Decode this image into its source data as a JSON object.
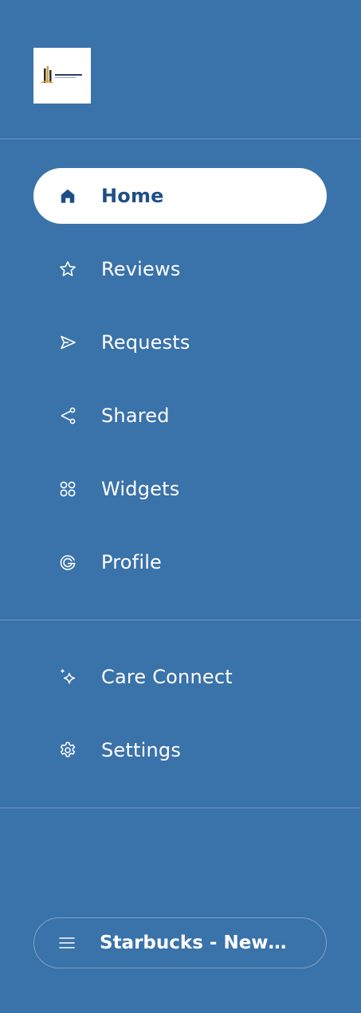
{
  "logo": {
    "alt_icon": "company-logo"
  },
  "nav": {
    "primary": [
      {
        "label": "Home",
        "icon": "home-icon",
        "active": true
      },
      {
        "label": "Reviews",
        "icon": "star-icon",
        "active": false
      },
      {
        "label": "Requests",
        "icon": "send-icon",
        "active": false
      },
      {
        "label": "Shared",
        "icon": "share-icon",
        "active": false
      },
      {
        "label": "Widgets",
        "icon": "widgets-icon",
        "active": false
      },
      {
        "label": "Profile",
        "icon": "google-icon",
        "active": false
      }
    ],
    "secondary": [
      {
        "label": "Care Connect",
        "icon": "sparkle-icon"
      },
      {
        "label": "Settings",
        "icon": "gear-icon"
      }
    ]
  },
  "account": {
    "name": "Starbucks - New…",
    "icon": "menu-icon"
  },
  "colors": {
    "sidebar_bg": "#3a72aa",
    "active_bg": "#ffffff",
    "active_text": "#1f4e87",
    "text": "#ffffff"
  }
}
